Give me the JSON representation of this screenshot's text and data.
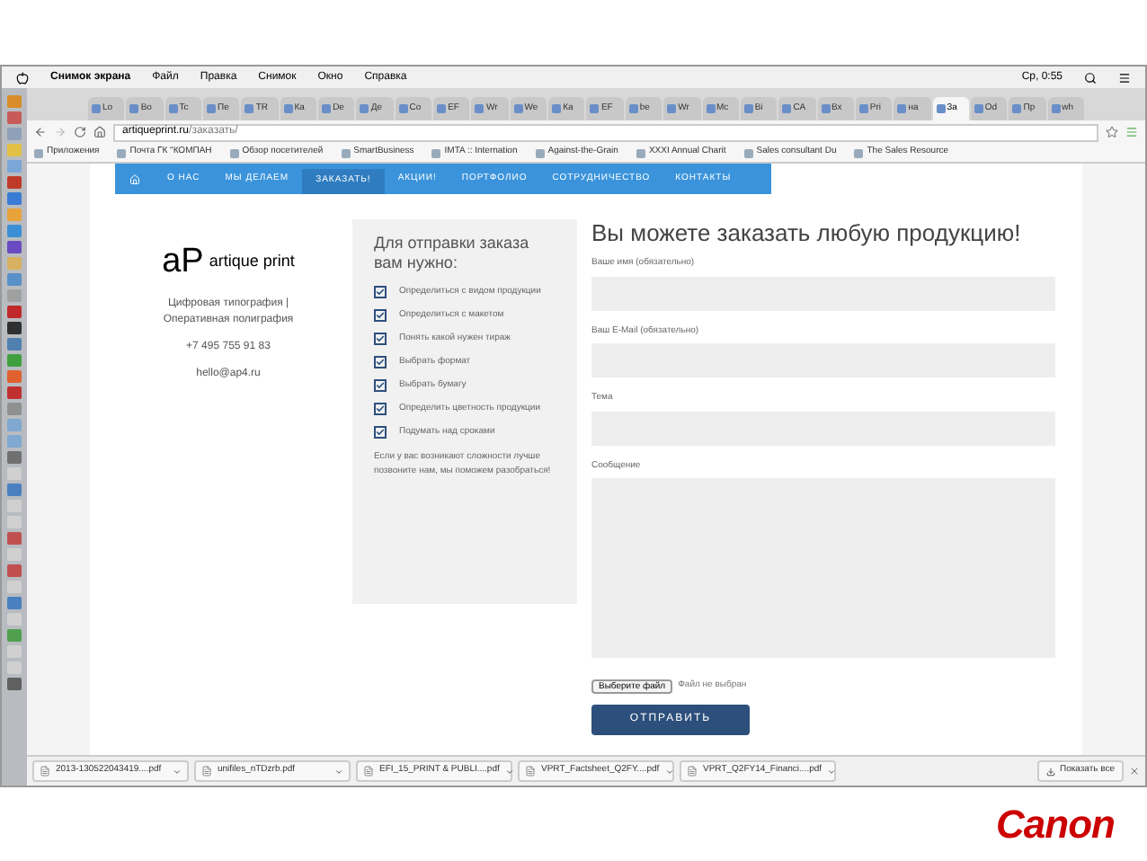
{
  "menu_bar": {
    "app": "Снимок экрана",
    "items": [
      "Файл",
      "Правка",
      "Снимок",
      "Окно",
      "Справка"
    ],
    "clock": "Ср, 0:55"
  },
  "tabs": [
    {
      "label": "Lo",
      "selected": false
    },
    {
      "label": "Bo",
      "selected": false
    },
    {
      "label": "Tc",
      "selected": false
    },
    {
      "label": "Пе",
      "selected": false
    },
    {
      "label": "TR",
      "selected": false
    },
    {
      "label": "Ка",
      "selected": false
    },
    {
      "label": "De",
      "selected": false
    },
    {
      "label": "Де",
      "selected": false
    },
    {
      "label": "Co",
      "selected": false
    },
    {
      "label": "EF",
      "selected": false
    },
    {
      "label": "Wr",
      "selected": false
    },
    {
      "label": "We",
      "selected": false
    },
    {
      "label": "Ка",
      "selected": false
    },
    {
      "label": "EF",
      "selected": false
    },
    {
      "label": "be",
      "selected": false
    },
    {
      "label": "Wr",
      "selected": false
    },
    {
      "label": "Mc",
      "selected": false
    },
    {
      "label": "Bi",
      "selected": false
    },
    {
      "label": "CA",
      "selected": false
    },
    {
      "label": "Вх",
      "selected": false
    },
    {
      "label": "Pri",
      "selected": false
    },
    {
      "label": "на",
      "selected": false
    },
    {
      "label": "За",
      "selected": true
    },
    {
      "label": "Od",
      "selected": false
    },
    {
      "label": "Пр",
      "selected": false
    },
    {
      "label": "wh",
      "selected": false
    }
  ],
  "address": {
    "host": "artiqueprint.ru",
    "path": "/заказать/"
  },
  "bookmarks": [
    "Приложения",
    "Почта ГК \"КОМПАН",
    "Обзор посетителей",
    "SmartBusiness",
    "IMTA :: Internation",
    "Against-the-Grain",
    "XXXI Annual Charit",
    "Sales consultant Du",
    "The Sales Resource"
  ],
  "nav": [
    {
      "label": "О НАС",
      "selected": false
    },
    {
      "label": "МЫ ДЕЛАЕМ",
      "selected": false
    },
    {
      "label": "ЗАКАЗАТЬ!",
      "selected": true
    },
    {
      "label": "АКЦИИ!",
      "selected": false
    },
    {
      "label": "ПОРТФОЛИО",
      "selected": false
    },
    {
      "label": "СОТРУДНИЧЕСТВО",
      "selected": false
    },
    {
      "label": "КОНТАКТЫ",
      "selected": false
    }
  ],
  "company": {
    "logo_mark": "aP",
    "logo_text": "artique print",
    "tagline": "Цифровая типография | Оперативная полиграфия",
    "phone": "+7 495 755 91 83",
    "email": "hello@ap4.ru"
  },
  "checklist": {
    "title": "Для отправки заказа вам нужно:",
    "items": [
      {
        "label": "Определиться с видом продукции",
        "checked": true
      },
      {
        "label": "Определиться с макетом",
        "checked": true
      },
      {
        "label": "Понять какой нужен тираж",
        "checked": true
      },
      {
        "label": "Выбрать формат",
        "checked": true
      },
      {
        "label": "Выбрать бумагу",
        "checked": true
      },
      {
        "label": "Определить цветность продукции",
        "checked": true
      },
      {
        "label": "Подумать над сроками",
        "checked": true
      }
    ],
    "note": "Если у вас возникают сложности лучше позвоните нам, мы поможем разобраться!"
  },
  "form": {
    "title": "Вы можете заказать любую продукцию!",
    "fields": [
      {
        "label": "Ваше имя (обязательно)",
        "kind": "input"
      },
      {
        "label": "Ваш E-Mail (обязательно)",
        "kind": "input"
      },
      {
        "label": "Тема",
        "kind": "input"
      },
      {
        "label": "Сообщение",
        "kind": "textarea"
      }
    ],
    "file_button": "Выберите файл",
    "file_status": "Файл не выбран",
    "submit": "ОТПРАВИТЬ"
  },
  "downloads": {
    "items": [
      "2013-130522043419....pdf",
      "unifiles_nTDzrb.pdf",
      "EFI_15_PRINT & PUBLI....pdf",
      "VPRT_Factsheet_Q2FY....pdf",
      "VPRT_Q2FY14_Financi....pdf"
    ],
    "show_all": "Показать все"
  },
  "footer": {
    "logo": "Canon"
  }
}
